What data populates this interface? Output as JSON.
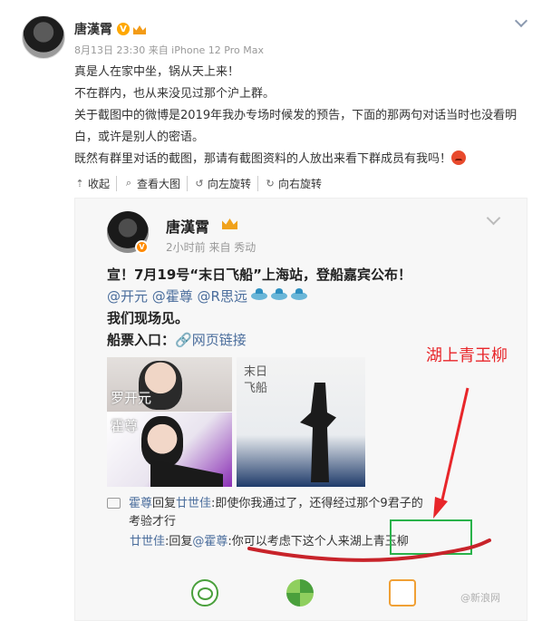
{
  "post": {
    "author": "唐漢霄",
    "verified_badge": "V",
    "meta": "8月13日 23:30 来自 iPhone 12 Pro Max",
    "lines": [
      "真是人在家中坐，锅从天上来！",
      "不在群内，也从来没见过那个沪上群。",
      "关于截图中的微博是2019年我办专场时候发的预告，下面的那两句对话当时也没看明白，或许是别人的密语。",
      "既然有群里对话的截图，那请有截图资料的人放出来看下群成员有我吗！"
    ],
    "actions": [
      {
        "icon": "collapse-arrow-icon",
        "glyph": "⇡",
        "label": "收起"
      },
      {
        "icon": "magnifier-icon",
        "glyph": "⌕",
        "label": "查看大图"
      },
      {
        "icon": "rotate-left-icon",
        "glyph": "↺",
        "label": "向左旋转"
      },
      {
        "icon": "rotate-right-icon",
        "glyph": "↻",
        "label": "向右旋转"
      }
    ]
  },
  "screenshot": {
    "author": "唐漢霄",
    "meta": "2小时前  来自 秀动",
    "headline": "宣！7月19号“末日飞船”上海站，登船嘉宾公布！",
    "mentions": "@开元 @霍尊 @R思远",
    "see_you": "我们现场见。",
    "ticket_label": "船票入口：",
    "ticket_link": "网页链接",
    "photo_label_1": "罗开元",
    "photo_label_2": "霍尊",
    "album_title_1": "末日",
    "album_title_2": "飞船",
    "reply1_user": "霍尊",
    "reply1_mid": "回复",
    "reply1_target": "廿世佳",
    "reply1_text": ":即使你我通过了，还得经过那个9君子的",
    "reply1_text2": "考验才行",
    "reply2_user": "廿世佳",
    "reply2_mid": ":回复",
    "reply2_target": "@霍尊",
    "reply2_text": ":你可以考虑下这个人来湖上青玉柳",
    "watermark": "@新浪网"
  },
  "annotation": {
    "label": "湖上青玉柳",
    "color_label": "#e8262a",
    "color_box": "#29b24a"
  },
  "colors": {
    "link": "#4a6d9c",
    "badge": "#ffa800"
  }
}
